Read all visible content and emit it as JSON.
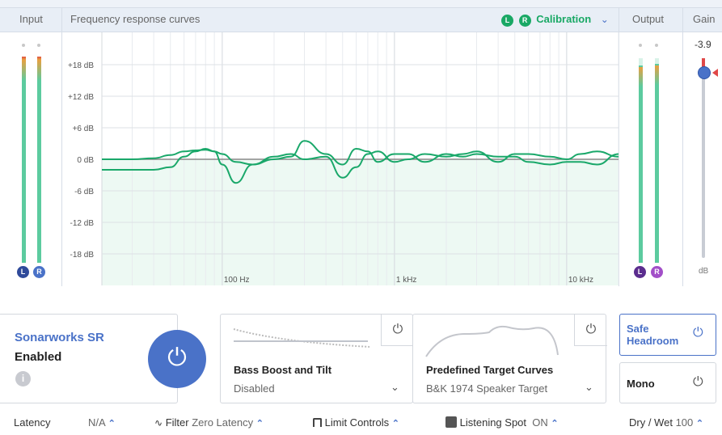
{
  "header": {
    "input": "Input",
    "curves": "Frequency response curves",
    "calibration": "Calibration",
    "output": "Output",
    "gain": "Gain",
    "badge_l": "L",
    "badge_r": "R"
  },
  "input": {
    "badge_l": "L",
    "badge_r": "R",
    "level_l": 0.92,
    "level_r": 0.92
  },
  "output": {
    "badge_l": "L",
    "badge_r": "R",
    "level_l": 0.92,
    "level_r": 0.93
  },
  "gain": {
    "value": "-3.9",
    "unit": "dB"
  },
  "colors": {
    "accent": "#4a72c8",
    "curve": "#1aa86a",
    "calibration": "#19a865",
    "output_l": "#5b2d8e",
    "output_r": "#a24fc8"
  },
  "chart_data": {
    "type": "line",
    "xscale": "log",
    "xlim": [
      20,
      20000
    ],
    "ylim": [
      -24,
      24
    ],
    "grid": true,
    "yticks": [
      {
        "v": 18,
        "label": "+18 dB"
      },
      {
        "v": 12,
        "label": "+12 dB"
      },
      {
        "v": 6,
        "label": "+6 dB"
      },
      {
        "v": 0,
        "label": "0 dB"
      },
      {
        "v": -6,
        "label": "-6 dB"
      },
      {
        "v": -12,
        "label": "-12 dB"
      },
      {
        "v": -18,
        "label": "-18 dB"
      }
    ],
    "xticks": [
      {
        "v": 100,
        "label": "100 Hz"
      },
      {
        "v": 1000,
        "label": "1 kHz"
      },
      {
        "v": 10000,
        "label": "10 kHz"
      }
    ],
    "x": [
      20,
      30,
      40,
      50,
      60,
      70,
      80,
      90,
      100,
      120,
      150,
      200,
      250,
      300,
      400,
      500,
      600,
      700,
      800,
      1000,
      1200,
      1500,
      2000,
      2500,
      3000,
      4000,
      5000,
      6000,
      8000,
      10000,
      12000,
      15000,
      20000
    ],
    "series": [
      {
        "values": [
          0,
          0,
          0.2,
          0.8,
          1.5,
          1.7,
          1.8,
          1.5,
          -1,
          -4.5,
          -1,
          0.5,
          1,
          0,
          0.5,
          -3.5,
          -1.5,
          1,
          1.5,
          -0.5,
          0,
          1,
          0.5,
          1,
          1.5,
          -0.5,
          1,
          1,
          0.5,
          0,
          1,
          1.5,
          0.5
        ]
      },
      {
        "values": [
          -2,
          -2,
          -2,
          -1.5,
          0.5,
          1.5,
          2,
          1.5,
          1,
          -0.5,
          -1,
          0,
          0.5,
          3.5,
          1,
          -1,
          2,
          1.5,
          -0.5,
          1,
          1,
          -0.5,
          1,
          0.5,
          1,
          0.5,
          0.5,
          -0.5,
          -1,
          -0.5,
          -0.5,
          -1,
          1
        ]
      }
    ]
  },
  "main": {
    "title": "Sonarworks SR",
    "status": "Enabled"
  },
  "bass": {
    "title": "Bass Boost and Tilt",
    "value": "Disabled"
  },
  "target": {
    "title": "Predefined Target Curves",
    "value": "B&K 1974 Speaker Target"
  },
  "safe": {
    "label1": "Safe",
    "label2": "Headroom"
  },
  "mono": {
    "label": "Mono"
  },
  "footer": {
    "latency_label": "Latency",
    "latency_value": "N/A",
    "filter_label": "Filter",
    "filter_value": "Zero Latency",
    "limit": "Limit Controls",
    "spot_label": "Listening Spot",
    "spot_value": "ON",
    "drywet_label": "Dry / Wet",
    "drywet_value": "100"
  }
}
